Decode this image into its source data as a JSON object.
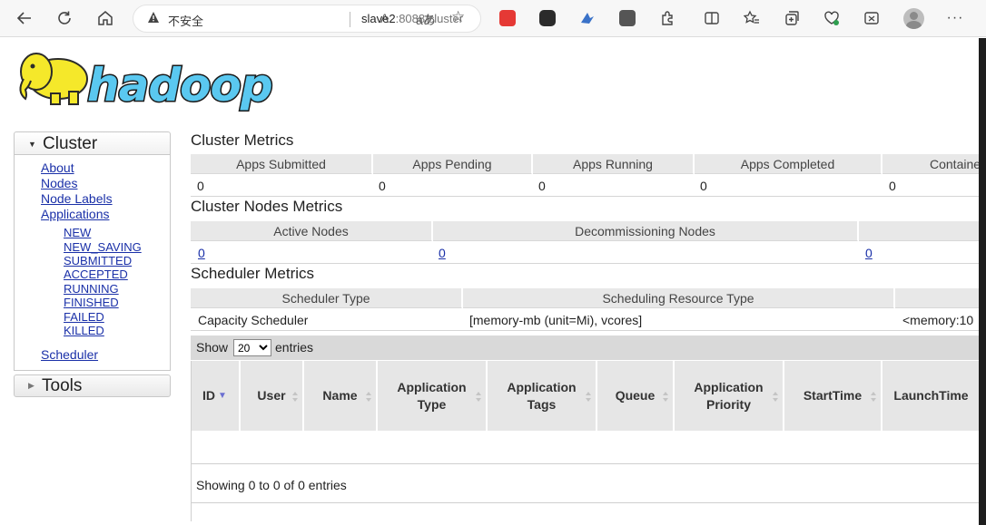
{
  "browser": {
    "insecure_label": "不安全",
    "url_host": "slave2",
    "url_rest": ":8088/cluster",
    "read_aloud_label": "A",
    "translate_label": "aあ"
  },
  "logo": {
    "text": "hadoop"
  },
  "sidebar": {
    "cluster_title": "Cluster",
    "links": [
      "About",
      "Nodes",
      "Node Labels",
      "Applications"
    ],
    "app_states": [
      "NEW",
      "NEW_SAVING",
      "SUBMITTED",
      "ACCEPTED",
      "RUNNING",
      "FINISHED",
      "FAILED",
      "KILLED"
    ],
    "scheduler_link": "Scheduler",
    "tools_title": "Tools"
  },
  "cluster_metrics": {
    "title": "Cluster Metrics",
    "headers": [
      "Apps Submitted",
      "Apps Pending",
      "Apps Running",
      "Apps Completed",
      "Containe"
    ],
    "values": [
      "0",
      "0",
      "0",
      "0",
      "0"
    ]
  },
  "nodes_metrics": {
    "title": "Cluster Nodes Metrics",
    "headers": [
      "Active Nodes",
      "Decommissioning Nodes",
      ""
    ],
    "values": [
      "0",
      "0",
      "0"
    ]
  },
  "scheduler_metrics": {
    "title": "Scheduler Metrics",
    "headers": [
      "Scheduler Type",
      "Scheduling Resource Type",
      ""
    ],
    "values": [
      "Capacity Scheduler",
      "[memory-mb (unit=Mi), vcores]",
      "<memory:10"
    ]
  },
  "apps_table": {
    "show_label": "Show",
    "entries_label": "entries",
    "page_size": "20",
    "page_size_options": [
      "20"
    ],
    "columns": [
      "ID",
      "User",
      "Name",
      "Application Type",
      "Application Tags",
      "Queue",
      "Application Priority",
      "StartTime",
      "LaunchTime"
    ],
    "info": "Showing 0 to 0 of 0 entries"
  },
  "colors": {
    "link": "#1a30a8",
    "header_bg": "#e8e8e8",
    "logo_yellow": "#f5e82a",
    "logo_blue": "#5ac8f0"
  },
  "icons": [
    "back-arrow-icon",
    "refresh-icon",
    "home-icon",
    "warning-icon",
    "favorite-star-icon",
    "extension-icon",
    "split-screen-icon",
    "favorites-icon",
    "collections-icon",
    "performance-icon",
    "screenshot-icon",
    "profile-icon",
    "more-icon",
    "sort-desc-icon"
  ]
}
